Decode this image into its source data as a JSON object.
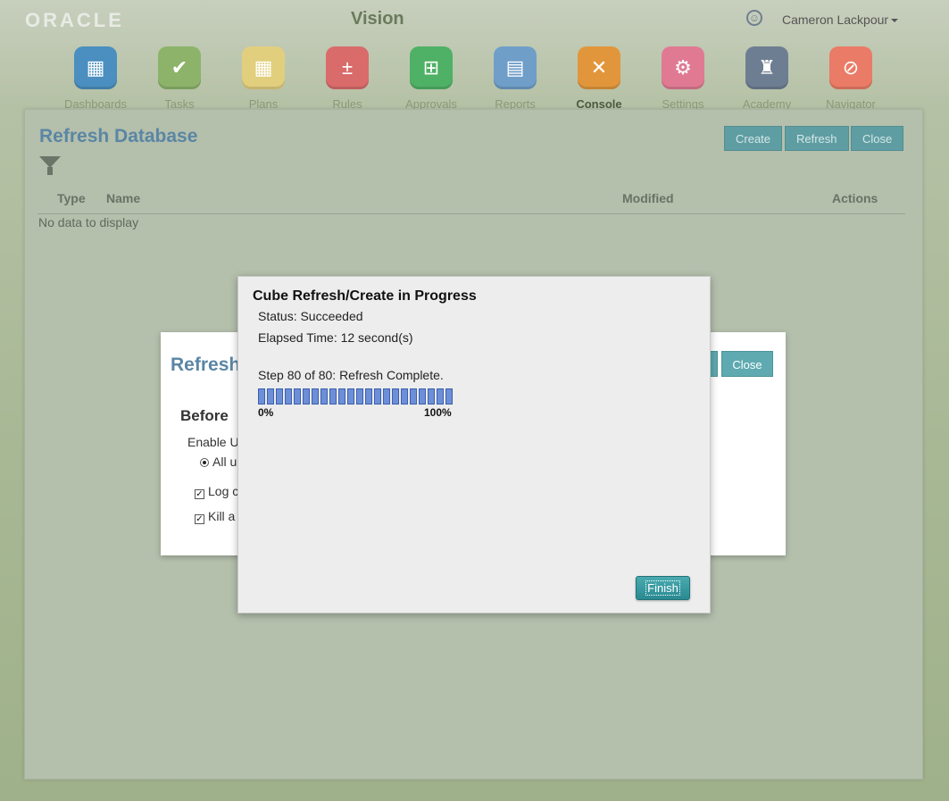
{
  "header": {
    "logo": "ORACLE",
    "app_title": "Vision",
    "user_name": "Cameron Lackpour"
  },
  "nav": [
    {
      "label": "Dashboards",
      "icon": "monitor-icon",
      "color": "#4a8fbf",
      "glyph": "▦"
    },
    {
      "label": "Tasks",
      "icon": "clipboard-check-icon",
      "color": "#8db36a",
      "glyph": "✔"
    },
    {
      "label": "Plans",
      "icon": "grid-icon",
      "color": "#e2cf7e",
      "glyph": "▦"
    },
    {
      "label": "Rules",
      "icon": "calculator-icon",
      "color": "#d96b6b",
      "glyph": "±"
    },
    {
      "label": "Approvals",
      "icon": "hierarchy-icon",
      "color": "#4fb165",
      "glyph": "⊞"
    },
    {
      "label": "Reports",
      "icon": "report-icon",
      "color": "#6f9ec9",
      "glyph": "▤"
    },
    {
      "label": "Console",
      "icon": "tools-icon",
      "color": "#e2963c",
      "glyph": "✕",
      "active": true
    },
    {
      "label": "Settings",
      "icon": "gears-icon",
      "color": "#e07a93",
      "glyph": "⚙"
    },
    {
      "label": "Academy",
      "icon": "academy-icon",
      "color": "#6e7e92",
      "glyph": "♜"
    },
    {
      "label": "Navigator",
      "icon": "compass-icon",
      "color": "#ea7b66",
      "glyph": "⊘"
    }
  ],
  "panel": {
    "title": "Refresh Database",
    "buttons": {
      "create": "Create",
      "refresh": "Refresh",
      "close": "Close"
    },
    "columns": {
      "type": "Type",
      "name": "Name",
      "modified": "Modified",
      "actions": "Actions"
    },
    "empty_text": "No data to display"
  },
  "bg_dialog": {
    "title": "Refresh",
    "close": "Close",
    "section": "Before",
    "enable_label": "Enable U",
    "radio_label": "All u",
    "check1_label": "Log c",
    "check2_label": "Kill a"
  },
  "modal": {
    "title": "Cube Refresh/Create in Progress",
    "status": "Status: Succeeded",
    "elapsed": "Elapsed Time: 12 second(s)",
    "step": "Step 80 of 80: Refresh Complete.",
    "progress": 1.0,
    "min_label": "0%",
    "max_label": "100%",
    "finish": "Finish"
  },
  "colors": {
    "accent": "#5a86a4",
    "button": "#5e9ea3",
    "progress_fill": "#6d8fd8"
  }
}
